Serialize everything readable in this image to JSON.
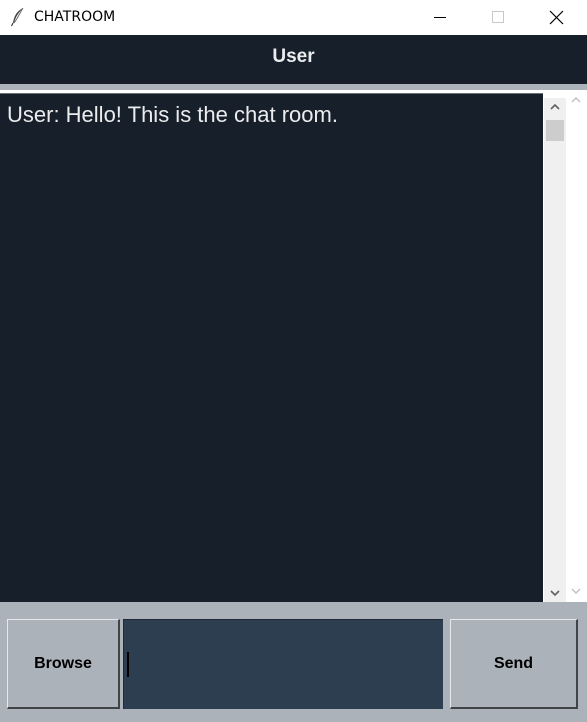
{
  "window": {
    "title": "CHATROOM",
    "app_icon": "feather-icon",
    "controls": [
      "minimize-icon",
      "maximize-icon",
      "close-icon"
    ]
  },
  "header": {
    "label": "User",
    "background": "#17202A",
    "text_color": "#EAECEE"
  },
  "chat": {
    "messages": [
      {
        "text": "User: Hello! This is the chat room."
      }
    ],
    "background": "#17202A",
    "text_color": "#EAECEE"
  },
  "bottom": {
    "browse_label": "Browse",
    "send_label": "Send",
    "message_value": "",
    "panel_color": "#ABB2B9",
    "input_color": "#2C3E50"
  }
}
